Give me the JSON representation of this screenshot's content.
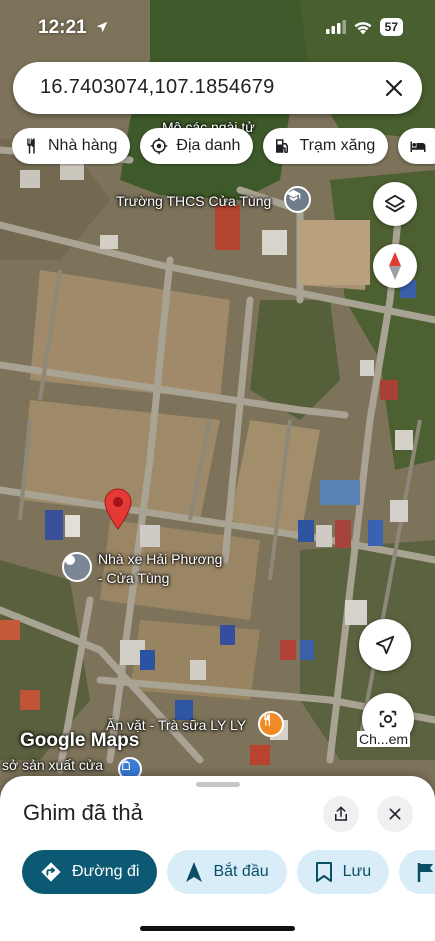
{
  "status": {
    "time": "12:21",
    "battery": "57"
  },
  "search": {
    "value": "16.7403074,107.1854679"
  },
  "chips": [
    {
      "label": "Nhà hàng",
      "icon": "fork-knife-icon"
    },
    {
      "label": "Địa danh",
      "icon": "landmark-icon"
    },
    {
      "label": "Trạm xăng",
      "icon": "gas-station-icon"
    },
    {
      "label": "",
      "icon": "bed-icon"
    }
  ],
  "map": {
    "labels": {
      "poi_top": "Mộ các ngài tử",
      "school": "Trường THCS Cửa Tùng",
      "bus": "Nhà xe Hải Phương",
      "bus_line2": "- Cửa Tùng",
      "snack": "Ăn vặt - Trà sữa LY LY",
      "factory": "sở sản xuất cửa",
      "google": "Google Maps"
    },
    "lens_label": "Ch...em",
    "pin_color": "#e53935"
  },
  "sheet": {
    "title": "Ghim đã thả",
    "actions": [
      {
        "label": "Đường đi",
        "icon": "directions-icon"
      },
      {
        "label": "Bắt đầu",
        "icon": "navigation-arrow-icon"
      },
      {
        "label": "Lưu",
        "icon": "bookmark-icon"
      },
      {
        "label": "",
        "icon": "flag-icon"
      }
    ]
  },
  "colors": {
    "accent": "#0b5972",
    "chip_bg": "#d9edf8",
    "pin": "#e53935",
    "compass_red": "#e53935"
  }
}
